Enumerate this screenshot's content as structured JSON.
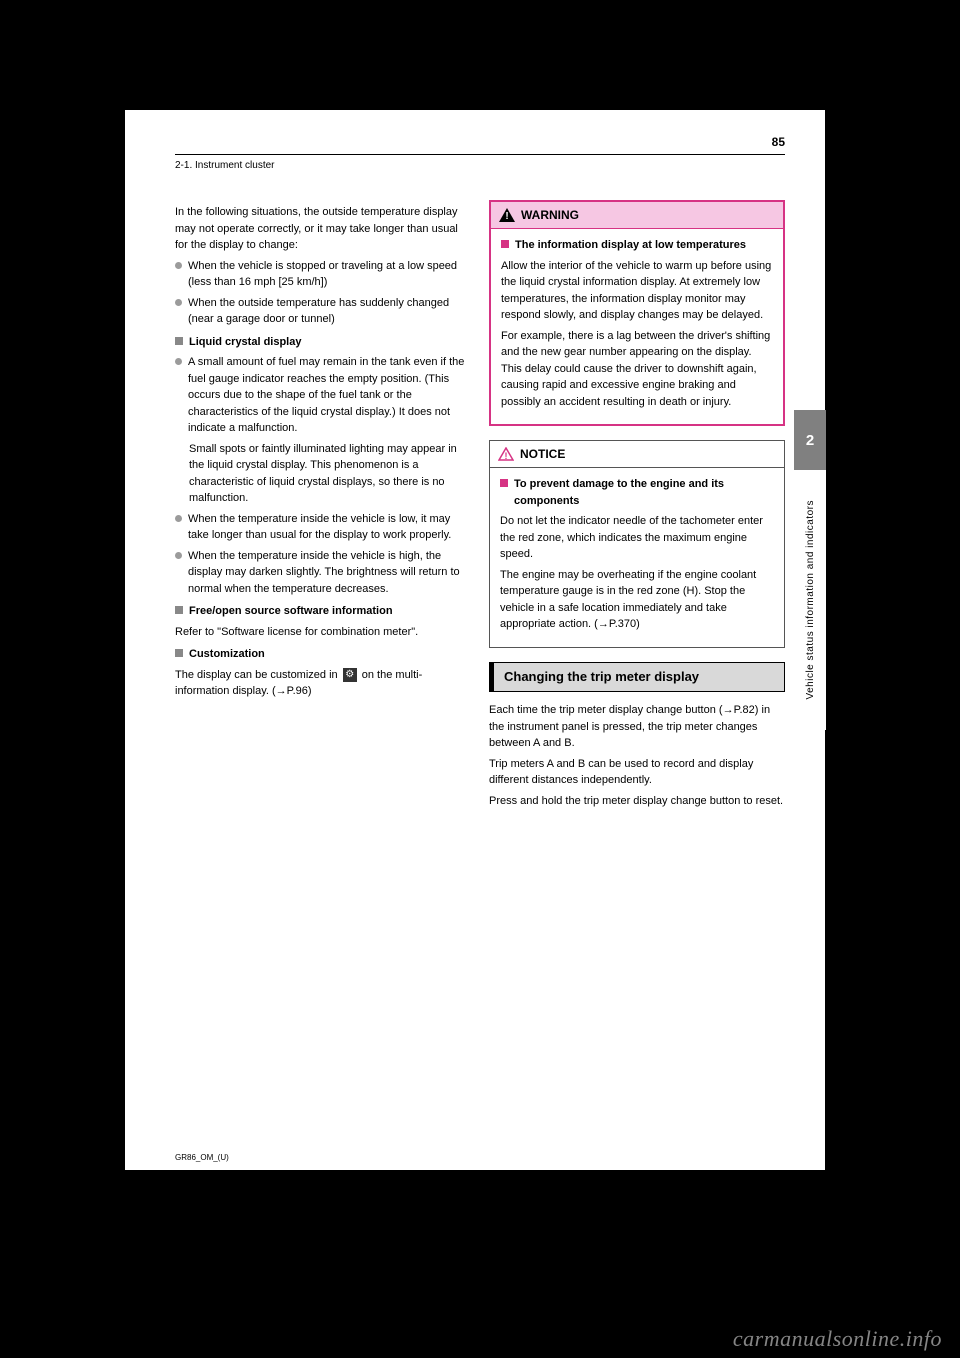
{
  "header": {
    "page_number": "85",
    "section_crumb": "2-1. Instrument cluster"
  },
  "side": {
    "chapter_num": "2",
    "chapter_label": "Vehicle status information and indicators"
  },
  "left_col": {
    "intro1": "In the following situations, the outside temperature display may not operate correctly, or it may take longer than usual for the display to change:",
    "intro1_b1": "When the vehicle is stopped or traveling at a low speed (less than 16 mph [25 km/h])",
    "intro1_b2": "When the outside temperature has suddenly changed (near a garage door or tunnel)",
    "sub1_title": "Liquid crystal display",
    "sub1_b1": "A small amount of fuel may remain in the tank even if the fuel gauge indicator reaches the empty position. (This occurs due to the shape of the fuel tank or the characteristics of the liquid crystal display.) It does not indicate a malfunction.",
    "sub1_p1": "Small spots or faintly illuminated lighting may appear in the liquid crystal display. This phenomenon is a characteristic of liquid crystal displays, so there is no malfunction.",
    "sub1_b2": "When the temperature inside the vehicle is low, it may take longer than usual for the display to work properly.",
    "sub1_b3": "When the temperature inside the vehicle is high, the display may darken slightly. The brightness will return to normal when the temperature decreases.",
    "sub2_title": "Free/open source software information",
    "sub2_p1": "Refer to \"Software license for combination meter\".",
    "sub3_title": "Customization",
    "sub3_p_pre": "The display can be customized in ",
    "sub3_p_post": " on the multi-information display. (→P.96)",
    "gear_icon_name": "settings-gear-icon"
  },
  "right_col": {
    "warning_label": "WARNING",
    "warning_sub_title": "The information display at low temperatures",
    "warning_p1": "Allow the interior of the vehicle to warm up before using the liquid crystal information display. At extremely low temperatures, the information display monitor may respond slowly, and display changes may be delayed.",
    "warning_p2": "For example, there is a lag between the driver's shifting and the new gear number appearing on the display. This delay could cause the driver to downshift again, causing rapid and excessive engine braking and possibly an accident resulting in death or injury.",
    "notice_label": "NOTICE",
    "notice_sub_title": "To prevent damage to the engine and its components",
    "notice_p1": "Do not let the indicator needle of the tachometer enter the red zone, which indicates the maximum engine speed.",
    "notice_p2": "The engine may be overheating if the engine coolant temperature gauge is in the red zone (H). Stop the vehicle in a safe location immediately and take appropriate action. (→P.370)",
    "topic_title": "Changing the trip meter display",
    "topic_p1": "Each time the trip meter display change button (→P.82) in the instrument panel is pressed, the trip meter changes between A and B.",
    "topic_p2": "Trip meters A and B can be used to record and display different distances independently.",
    "topic_p3": "Press and hold the trip meter display change button to reset."
  },
  "footer": {
    "book_code": "GR86_OM_(U)",
    "watermark": "carmanualsonline.info"
  }
}
